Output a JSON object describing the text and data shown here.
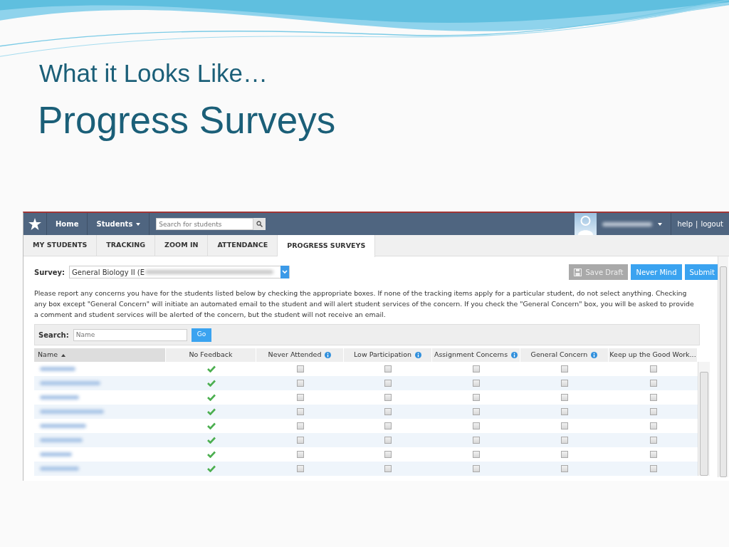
{
  "slide": {
    "subtitle": "What it Looks Like…",
    "title": "Progress Surveys"
  },
  "app": {
    "nav": [
      {
        "label": "Home",
        "dropdown": false
      },
      {
        "label": "Students",
        "dropdown": true
      }
    ],
    "search": {
      "placeholder": "Search for students"
    },
    "links": {
      "items": [
        "help",
        "logout"
      ],
      "separator": "|"
    },
    "tabs": [
      {
        "label": "MY STUDENTS",
        "selected": false
      },
      {
        "label": "TRACKING",
        "selected": false
      },
      {
        "label": "ZOOM IN",
        "selected": false
      },
      {
        "label": "ATTENDANCE",
        "selected": false
      },
      {
        "label": "PROGRESS SURVEYS",
        "selected": true
      }
    ],
    "survey": {
      "label": "Survey:",
      "value": "General Biology II (E"
    },
    "buttons": [
      {
        "label": "Save Draft",
        "kind": "draft",
        "disabled": true
      },
      {
        "label": "Never Mind",
        "kind": "plain",
        "disabled": false
      },
      {
        "label": "Submit",
        "kind": "plain",
        "disabled": false
      }
    ],
    "instructions": "Please report any concerns you have for the students listed below by checking the appropriate boxes.  If none of the tracking items apply for a particular student, do not select anything.  Checking any box except \"General Concern\" will initiate an automated email to the student and will alert student services of the concern.  If you check the \"General Concern\" box, you will be asked to provide a comment and student services will be alerted of the concern, but the student will not receive an email.",
    "filter": {
      "label": "Search:",
      "placeholder": "Name",
      "button": "Go"
    },
    "columns": [
      {
        "label": "Name",
        "sorted": true,
        "info": false
      },
      {
        "label": "No Feedback",
        "sorted": false,
        "info": false
      },
      {
        "label": "Never Attended",
        "sorted": false,
        "info": true
      },
      {
        "label": "Low Participation",
        "sorted": false,
        "info": true
      },
      {
        "label": "Assignment Concerns",
        "sorted": false,
        "info": true
      },
      {
        "label": "General Concern",
        "sorted": false,
        "info": true
      },
      {
        "label": "Keep up the Good Work...",
        "sorted": false,
        "info": false
      }
    ],
    "rows": [
      {
        "no_feedback": true,
        "checks": [
          false,
          false,
          false,
          false,
          false
        ]
      },
      {
        "no_feedback": true,
        "checks": [
          false,
          false,
          false,
          false,
          false
        ]
      },
      {
        "no_feedback": true,
        "checks": [
          false,
          false,
          false,
          false,
          false
        ]
      },
      {
        "no_feedback": true,
        "checks": [
          false,
          false,
          false,
          false,
          false
        ]
      },
      {
        "no_feedback": true,
        "checks": [
          false,
          false,
          false,
          false,
          false
        ]
      },
      {
        "no_feedback": true,
        "checks": [
          false,
          false,
          false,
          false,
          false
        ]
      },
      {
        "no_feedback": true,
        "checks": [
          false,
          false,
          false,
          false,
          false
        ]
      },
      {
        "no_feedback": true,
        "checks": [
          false,
          false,
          false,
          false,
          false
        ]
      }
    ]
  }
}
